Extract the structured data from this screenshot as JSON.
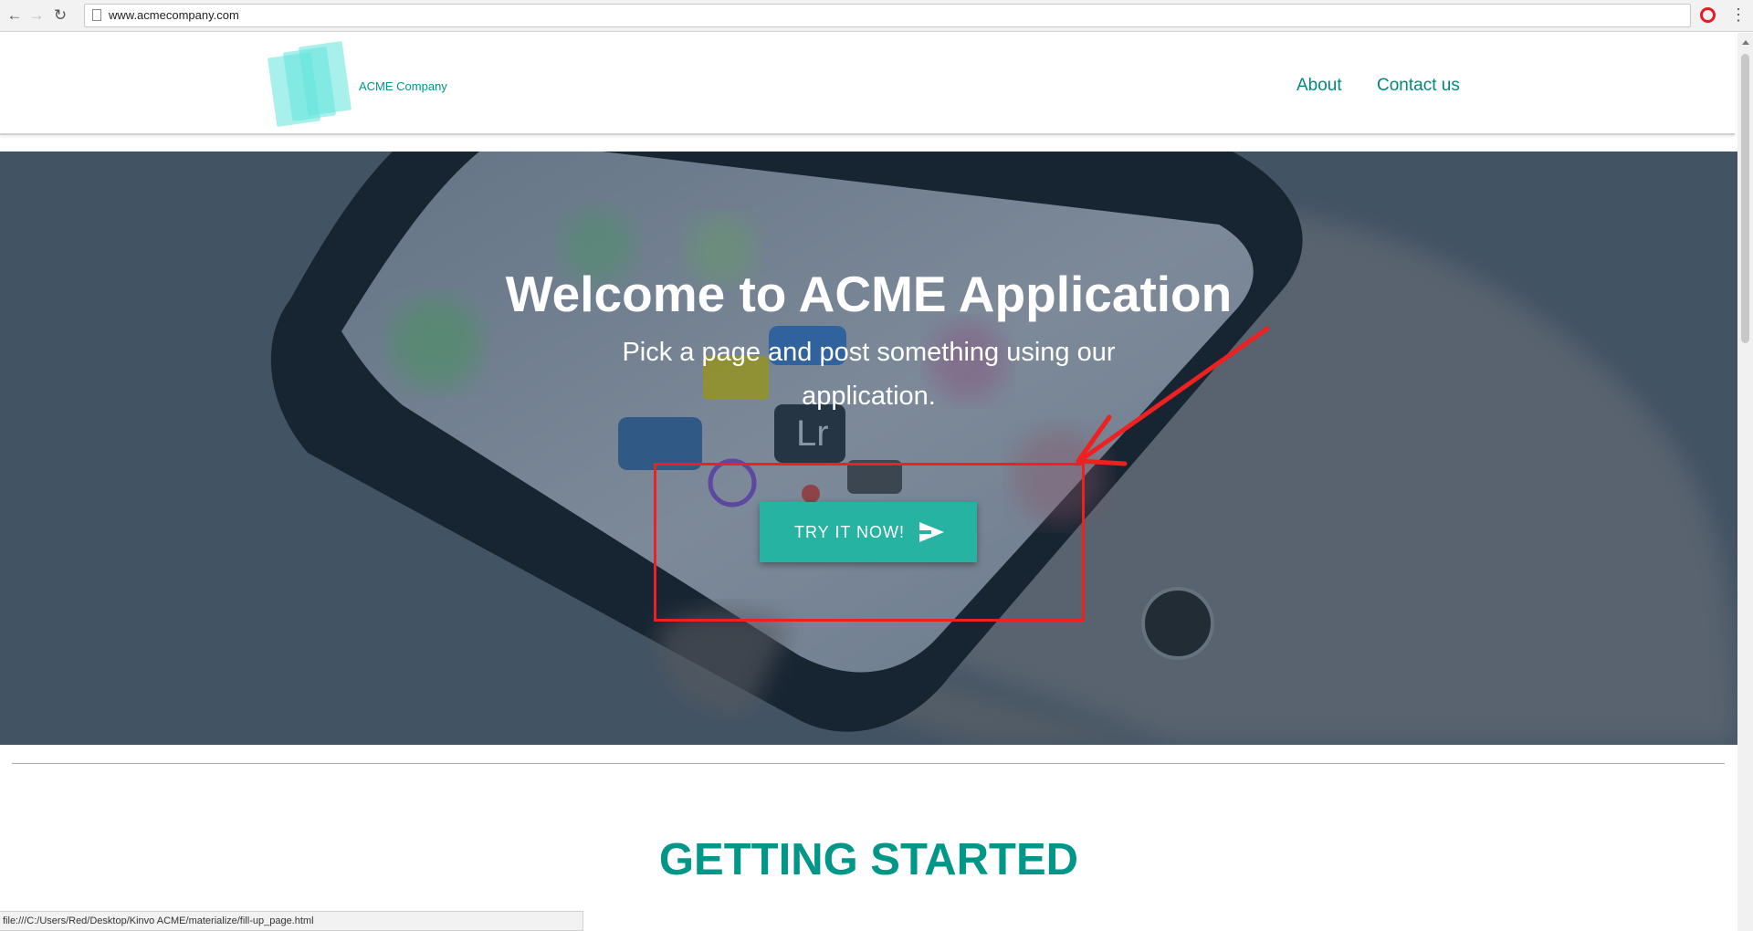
{
  "browser": {
    "url": "www.acmecompany.com",
    "status_url": "file:///C:/Users/Red/Desktop/Kinvo ACME/materialize/fill-up_page.html"
  },
  "site": {
    "brand_name": "ACME Company",
    "nav": {
      "about": "About",
      "contact": "Contact us"
    }
  },
  "hero": {
    "title": "Welcome to ACME Application",
    "subtitle": "Pick a page and post something using our application.",
    "cta_label": "TRY IT NOW!"
  },
  "section": {
    "title": "GETTING STARTED"
  },
  "colors": {
    "accent": "#009688",
    "button": "#26b3a2",
    "annotation": "#ee2020"
  },
  "icons": {
    "back": "back-arrow-icon",
    "forward": "forward-arrow-icon",
    "reload": "reload-icon",
    "browser_badge": "opera-icon",
    "menu": "more-vertical-icon",
    "cta": "send-icon"
  }
}
